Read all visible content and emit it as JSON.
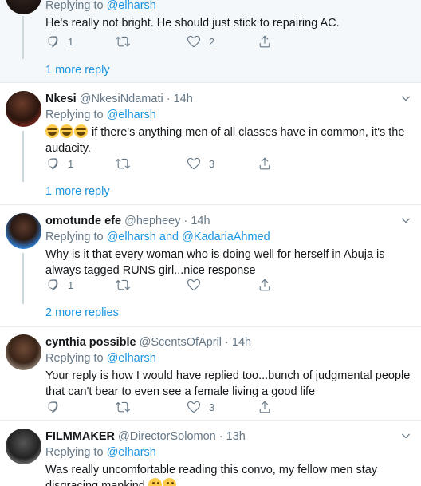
{
  "tweets": [
    {
      "name": "",
      "handle": "",
      "time": "",
      "replying_prefix": "Replying to ",
      "replying_to": "@elharsh",
      "text": "He's really not bright. He should just stick to repairing AC.",
      "emojis": [],
      "reply_count": "1",
      "retweet_count": "",
      "like_count": "2",
      "more_replies": "1 more reply"
    },
    {
      "name": "Nkesi",
      "handle": "@NkesiNdamati",
      "time": "14h",
      "replying_prefix": "Replying to ",
      "replying_to": "@elharsh",
      "text": " if there's anything men of all classes have in common, it's the audacity.",
      "emojis": [
        "face-with-tears-of-joy",
        "face-with-tears-of-joy",
        "face-with-tears-of-joy"
      ],
      "reply_count": "1",
      "retweet_count": "",
      "like_count": "3",
      "more_replies": "1 more reply"
    },
    {
      "name": "omotunde efe",
      "handle": "@hepheey",
      "time": "14h",
      "replying_prefix": "Replying to ",
      "replying_to": "@elharsh and @KadariaAhmed",
      "text": "Why is it that every woman who is doing well for herself in Abuja is always tagged RUNS girl...nice response",
      "emojis": [],
      "reply_count": "1",
      "retweet_count": "",
      "like_count": "",
      "more_replies": "2 more replies"
    },
    {
      "name": "cynthia possible",
      "handle": "@ScentsOfApril",
      "time": "14h",
      "replying_prefix": "Replying to ",
      "replying_to": "@elharsh",
      "text": "Your reply is how I would have replied too...bunch of judgmental people that can't bear to even see a female living a good life",
      "emojis": [],
      "reply_count": "",
      "retweet_count": "",
      "like_count": "3",
      "more_replies": ""
    },
    {
      "name": "FILMMAKER",
      "handle": "@DirectorSolomon",
      "time": "13h",
      "replying_prefix": "Replying to ",
      "replying_to": "@elharsh",
      "text": "Was really uncomfortable reading this convo, my fellow men stay disgracing mankind ",
      "emojis": [
        "thinking-face",
        "thinking-face"
      ],
      "reply_count": "",
      "retweet_count": "",
      "like_count": "",
      "more_replies": ""
    }
  ],
  "icons": {
    "reply": "reply-icon",
    "retweet": "retweet-icon",
    "like": "heart-icon",
    "share": "share-icon",
    "menu": "chevron-down-icon"
  },
  "separator": " · ",
  "colors": {
    "link": "#1b95e0",
    "muted": "#657786",
    "text": "#14171a",
    "border": "#e6ecf0",
    "first_bg": "#f5f8fa"
  }
}
